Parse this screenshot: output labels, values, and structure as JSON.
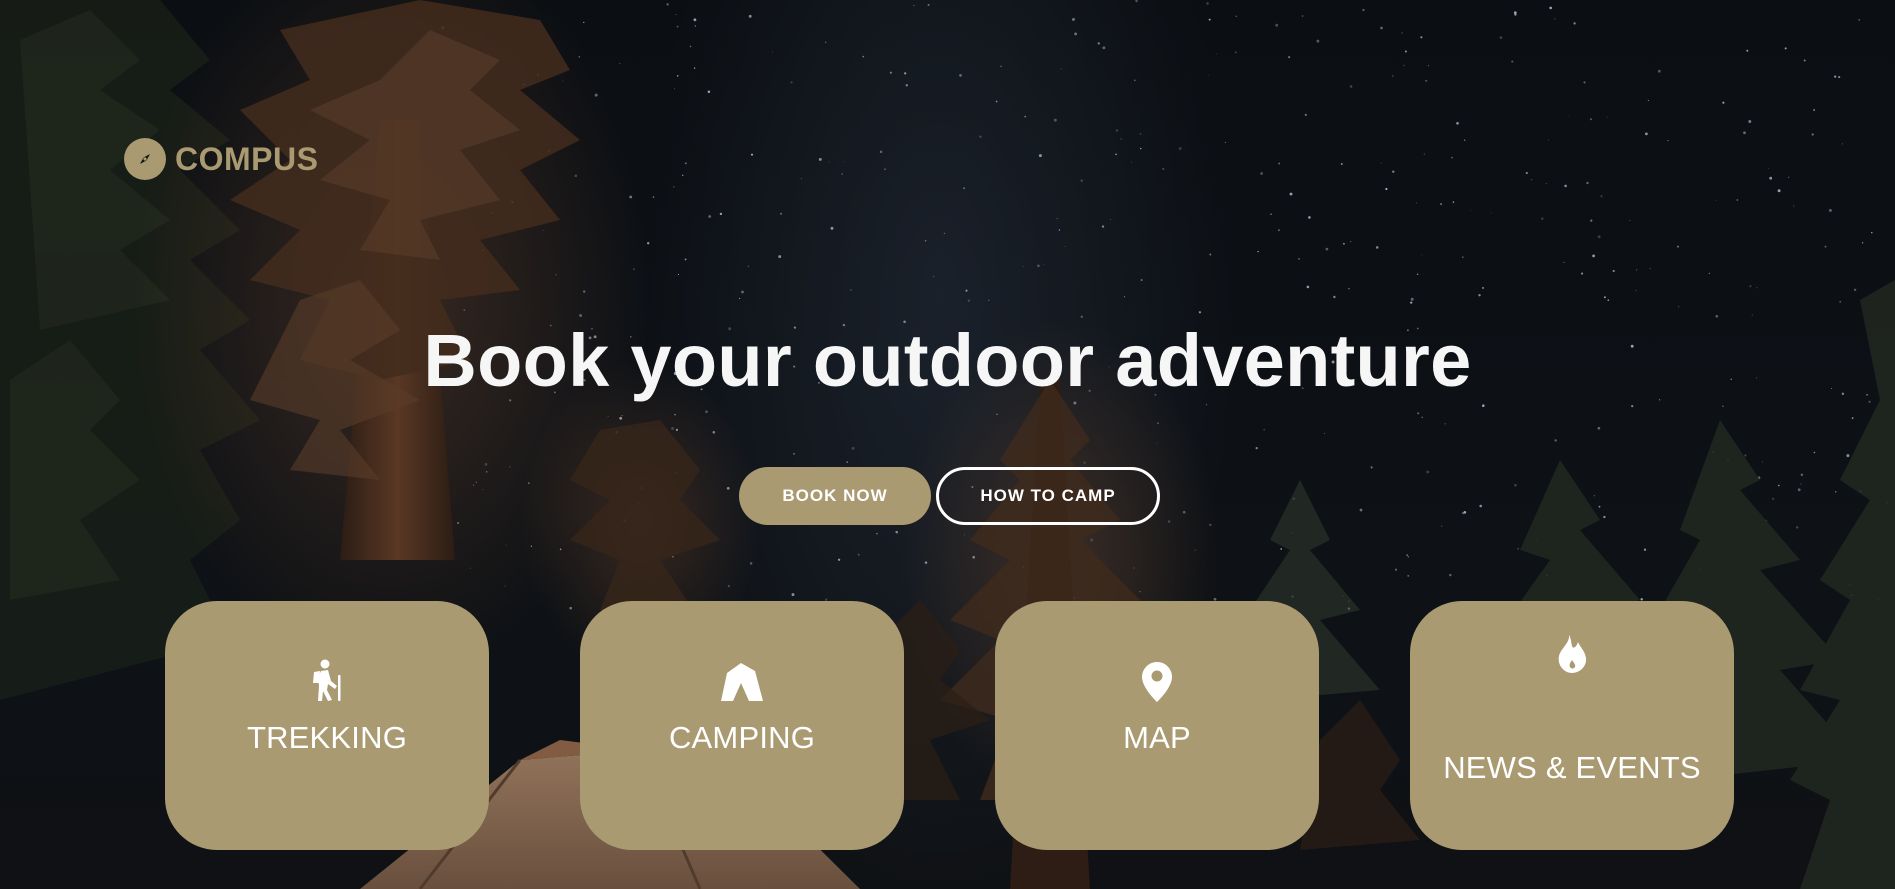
{
  "brand": {
    "name": "COMPUS",
    "icon": "compass-icon",
    "color": "#a99a72"
  },
  "hero": {
    "headline": "Book your outdoor adventure"
  },
  "actions": {
    "book_now": "BOOK NOW",
    "how_to_camp": "HOW TO CAMP"
  },
  "cards": [
    {
      "label": "TREKKING",
      "icon": "hiker-icon"
    },
    {
      "label": "CAMPING",
      "icon": "tent-icon"
    },
    {
      "label": "MAP",
      "icon": "map-pin-icon"
    },
    {
      "label": "NEWS & EVENTS",
      "icon": "fire-icon"
    }
  ],
  "colors": {
    "accent": "#aa9a72",
    "text_light": "#ffffff"
  }
}
